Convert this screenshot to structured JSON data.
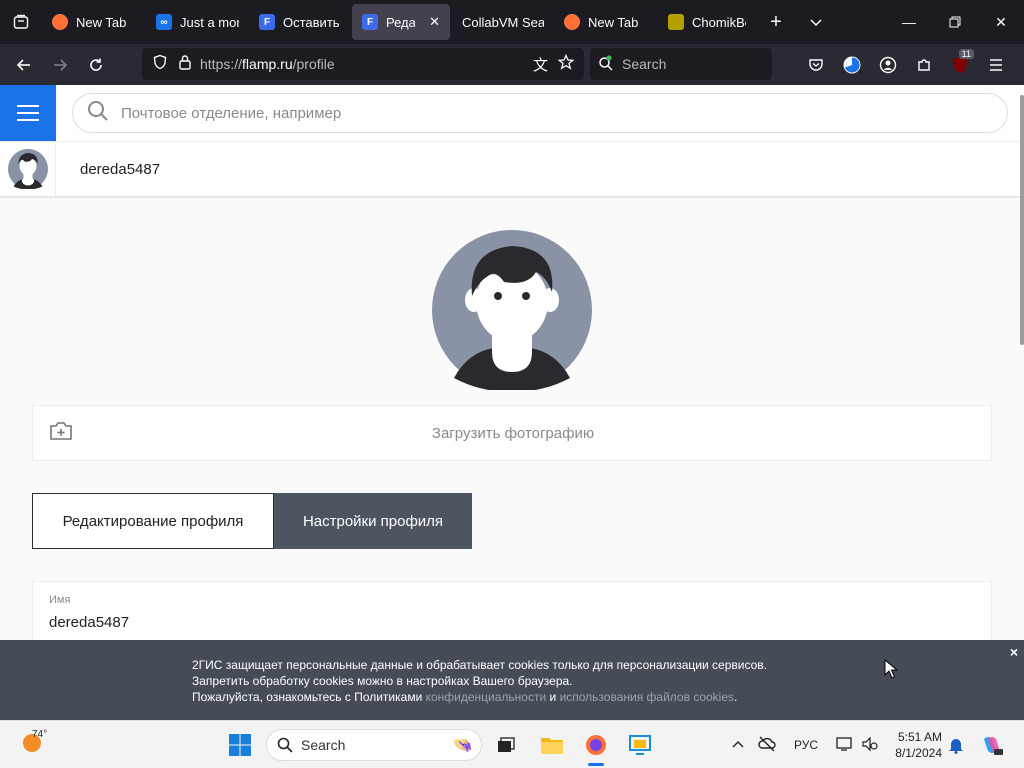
{
  "browser": {
    "tabs": [
      {
        "title": "New Tab",
        "favicon": "firefox-icon",
        "color": "#ff7139"
      },
      {
        "title": "Just a mom",
        "favicon": "link-icon",
        "color": "#1a73e8"
      },
      {
        "title": "Оставить о",
        "favicon": "flamp-icon",
        "color": "#3d6ae8"
      },
      {
        "title": "Редакти",
        "favicon": "flamp-icon",
        "color": "#3d6ae8",
        "active": true
      },
      {
        "title": "CollabVM Sear",
        "favicon": "none"
      },
      {
        "title": "New Tab",
        "favicon": "firefox-icon",
        "color": "#ff7139"
      },
      {
        "title": "ChomikBo",
        "favicon": "chomik-icon",
        "color": "#b5a000"
      }
    ],
    "url_prefix": "https://",
    "url_host": "flamp.ru",
    "url_path": "/profile",
    "search_placeholder": "Search",
    "extension_badge": "11"
  },
  "site": {
    "search_placeholder": "Почтовое отделение, например",
    "username": "dereda5487",
    "upload_label": "Загрузить фотографию",
    "profile_tabs": [
      "Редактирование профиля",
      "Настройки профиля"
    ],
    "field_label": "Имя",
    "field_value": "dereda5487",
    "accent_color": "#1a73e8"
  },
  "cookie_banner": {
    "line1": "2ГИС защищает персональные данные и обрабатывает cookies только для персонализации сервисов.",
    "line2": "Запретить обработку cookies можно в настройках Вашего браузера.",
    "line3_start": "Пожалуйста, ознакомьтесь с Политиками ",
    "link1": "конфиденциальности",
    "line3_and": " и ",
    "link2": "использования файлов cookies",
    "line3_end": ".",
    "close_label": "×"
  },
  "taskbar": {
    "weather_temp": "74°",
    "search_label": "Search",
    "language": "РУС",
    "time": "5:51 AM",
    "date": "8/1/2024"
  }
}
